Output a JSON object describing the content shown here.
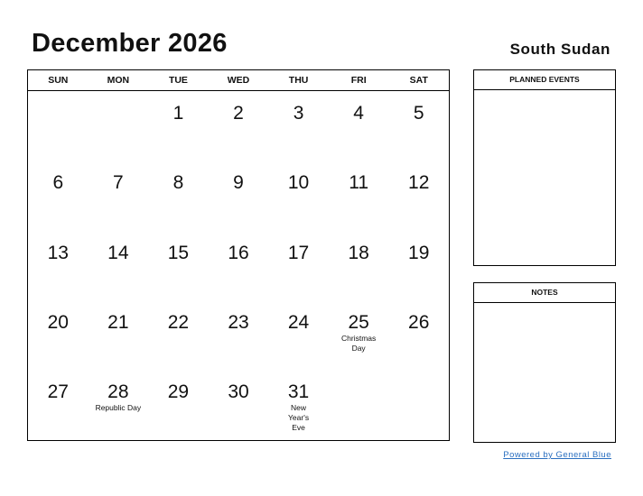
{
  "header": {
    "title": "December 2026",
    "country": "South Sudan"
  },
  "calendar": {
    "weekdays": [
      "SUN",
      "MON",
      "TUE",
      "WED",
      "THU",
      "FRI",
      "SAT"
    ],
    "cells": [
      {
        "day": "",
        "holiday": ""
      },
      {
        "day": "",
        "holiday": ""
      },
      {
        "day": "1",
        "holiday": ""
      },
      {
        "day": "2",
        "holiday": ""
      },
      {
        "day": "3",
        "holiday": ""
      },
      {
        "day": "4",
        "holiday": ""
      },
      {
        "day": "5",
        "holiday": ""
      },
      {
        "day": "6",
        "holiday": ""
      },
      {
        "day": "7",
        "holiday": ""
      },
      {
        "day": "8",
        "holiday": ""
      },
      {
        "day": "9",
        "holiday": ""
      },
      {
        "day": "10",
        "holiday": ""
      },
      {
        "day": "11",
        "holiday": ""
      },
      {
        "day": "12",
        "holiday": ""
      },
      {
        "day": "13",
        "holiday": ""
      },
      {
        "day": "14",
        "holiday": ""
      },
      {
        "day": "15",
        "holiday": ""
      },
      {
        "day": "16",
        "holiday": ""
      },
      {
        "day": "17",
        "holiday": ""
      },
      {
        "day": "18",
        "holiday": ""
      },
      {
        "day": "19",
        "holiday": ""
      },
      {
        "day": "20",
        "holiday": ""
      },
      {
        "day": "21",
        "holiday": ""
      },
      {
        "day": "22",
        "holiday": ""
      },
      {
        "day": "23",
        "holiday": ""
      },
      {
        "day": "24",
        "holiday": ""
      },
      {
        "day": "25",
        "holiday": "Christmas Day"
      },
      {
        "day": "26",
        "holiday": ""
      },
      {
        "day": "27",
        "holiday": ""
      },
      {
        "day": "28",
        "holiday": "Republic Day"
      },
      {
        "day": "29",
        "holiday": ""
      },
      {
        "day": "30",
        "holiday": ""
      },
      {
        "day": "31",
        "holiday": "New Year's Eve"
      },
      {
        "day": "",
        "holiday": ""
      },
      {
        "day": "",
        "holiday": ""
      }
    ]
  },
  "panels": {
    "planned_events": "PLANNED EVENTS",
    "notes": "NOTES"
  },
  "footer": {
    "powered_by": "Powered by General Blue",
    "link_color": "#2a6fc0"
  }
}
